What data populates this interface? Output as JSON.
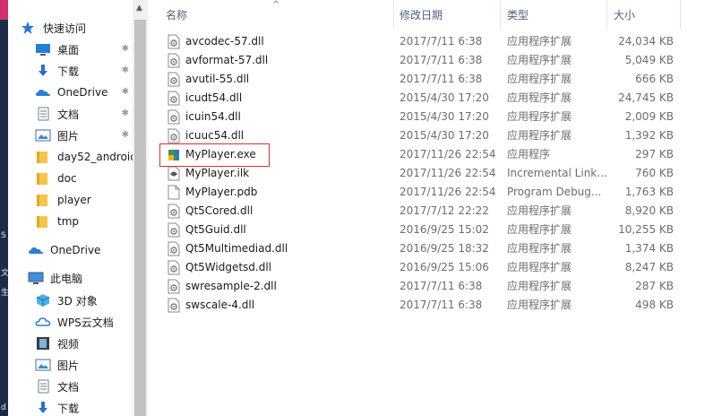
{
  "colors": {
    "folder": "#f5c644",
    "highlight": "#d9302d",
    "header_text": "#4c607a",
    "onedrive": "#2a7fd4"
  },
  "nav": {
    "quick_access": "快速访问",
    "items": [
      {
        "label": "桌面",
        "icon": "desktop-icon",
        "pinned": true
      },
      {
        "label": "下载",
        "icon": "download-icon",
        "pinned": true
      },
      {
        "label": "OneDrive",
        "icon": "onedrive-icon",
        "pinned": true
      },
      {
        "label": "文档",
        "icon": "document-icon",
        "pinned": true
      },
      {
        "label": "图片",
        "icon": "pictures-icon",
        "pinned": true
      },
      {
        "label": "day52_android",
        "icon": "folder-icon",
        "pinned": false
      },
      {
        "label": "doc",
        "icon": "folder-icon",
        "pinned": false
      },
      {
        "label": "player",
        "icon": "folder-icon",
        "pinned": false
      },
      {
        "label": "tmp",
        "icon": "folder-icon",
        "pinned": false
      }
    ],
    "onedrive": "OneDrive",
    "this_pc": "此电脑",
    "pc_items": [
      {
        "label": "3D 对象",
        "icon": "3d-objects-icon"
      },
      {
        "label": "WPS云文档",
        "icon": "wps-cloud-icon"
      },
      {
        "label": "视频",
        "icon": "video-icon"
      },
      {
        "label": "图片",
        "icon": "pictures-icon"
      },
      {
        "label": "文档",
        "icon": "document-icon"
      },
      {
        "label": "下载",
        "icon": "download-icon"
      }
    ]
  },
  "columns": {
    "name": "名称",
    "date": "修改日期",
    "type": "类型",
    "size": "大小"
  },
  "files": [
    {
      "name": "avcodec-57.dll",
      "date": "2017/7/11 6:38",
      "type": "应用程序扩展",
      "size": "24,034 KB",
      "icon": "dll-icon"
    },
    {
      "name": "avformat-57.dll",
      "date": "2017/7/11 6:38",
      "type": "应用程序扩展",
      "size": "5,049 KB",
      "icon": "dll-icon"
    },
    {
      "name": "avutil-55.dll",
      "date": "2017/7/11 6:38",
      "type": "应用程序扩展",
      "size": "666 KB",
      "icon": "dll-icon"
    },
    {
      "name": "icudt54.dll",
      "date": "2015/4/30 17:20",
      "type": "应用程序扩展",
      "size": "24,745 KB",
      "icon": "dll-icon"
    },
    {
      "name": "icuin54.dll",
      "date": "2015/4/30 17:20",
      "type": "应用程序扩展",
      "size": "2,009 KB",
      "icon": "dll-icon"
    },
    {
      "name": "icuuc54.dll",
      "date": "2015/4/30 17:20",
      "type": "应用程序扩展",
      "size": "1,392 KB",
      "icon": "dll-icon"
    },
    {
      "name": "MyPlayer.exe",
      "date": "2017/11/26 22:54",
      "type": "应用程序",
      "size": "297 KB",
      "icon": "exe-icon"
    },
    {
      "name": "MyPlayer.ilk",
      "date": "2017/11/26 22:54",
      "type": "Incremental Link...",
      "size": "760 KB",
      "icon": "ilk-icon"
    },
    {
      "name": "MyPlayer.pdb",
      "date": "2017/11/26 22:54",
      "type": "Program Debug...",
      "size": "1,763 KB",
      "icon": "file-icon"
    },
    {
      "name": "Qt5Cored.dll",
      "date": "2017/7/12 22:22",
      "type": "应用程序扩展",
      "size": "8,920 KB",
      "icon": "dll-icon"
    },
    {
      "name": "Qt5Guid.dll",
      "date": "2016/9/25 15:02",
      "type": "应用程序扩展",
      "size": "10,255 KB",
      "icon": "dll-icon"
    },
    {
      "name": "Qt5Multimediad.dll",
      "date": "2016/9/25 18:32",
      "type": "应用程序扩展",
      "size": "1,374 KB",
      "icon": "dll-icon"
    },
    {
      "name": "Qt5Widgetsd.dll",
      "date": "2016/9/25 15:06",
      "type": "应用程序扩展",
      "size": "8,247 KB",
      "icon": "dll-icon"
    },
    {
      "name": "swresample-2.dll",
      "date": "2017/7/11 6:38",
      "type": "应用程序扩展",
      "size": "287 KB",
      "icon": "dll-icon"
    },
    {
      "name": "swscale-4.dll",
      "date": "2017/7/11 6:38",
      "type": "应用程序扩展",
      "size": "498 KB",
      "icon": "dll-icon"
    }
  ],
  "edge_glyphs": [
    "S",
    "文",
    "生",
    "d"
  ]
}
